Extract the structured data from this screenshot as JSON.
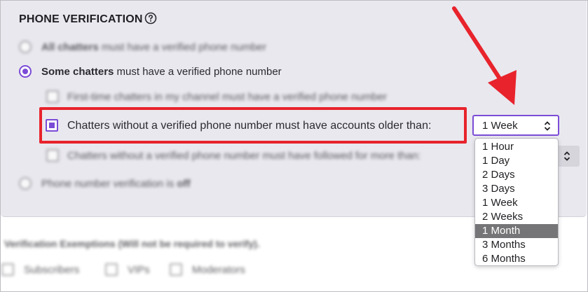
{
  "section": {
    "title": "PHONE VERIFICATION",
    "help_icon": "help-circle-icon"
  },
  "options": {
    "all_chatters": {
      "bold": "All chatters",
      "rest": " must have a verified phone number"
    },
    "some_chatters": {
      "bold": "Some chatters",
      "rest": " must have a verified phone number"
    },
    "first_time": "First-time chatters in my channel must have a verified phone number",
    "account_age": "Chatters without a verified phone number must have accounts older than:",
    "followed": "Chatters without a verified phone number must have followed for more than:",
    "off": {
      "text": "Phone number verification is ",
      "bold": "off"
    }
  },
  "account_age_select": {
    "value": "1 Week",
    "options": [
      "1 Hour",
      "1 Day",
      "2 Days",
      "3 Days",
      "1 Week",
      "2 Weeks",
      "1 Month",
      "3 Months",
      "6 Months"
    ],
    "highlighted": "1 Month"
  },
  "exemptions": {
    "title": "Verification Exemptions (Will not be required to verify).",
    "subscribers": "Subscribers",
    "vips": "VIPs",
    "moderators": "Moderators"
  },
  "colors": {
    "accent": "#7b4cd6",
    "highlight_box": "#e8232c",
    "annotation_arrow": "#e8232c",
    "panel_bg": "#e9e8ee"
  }
}
